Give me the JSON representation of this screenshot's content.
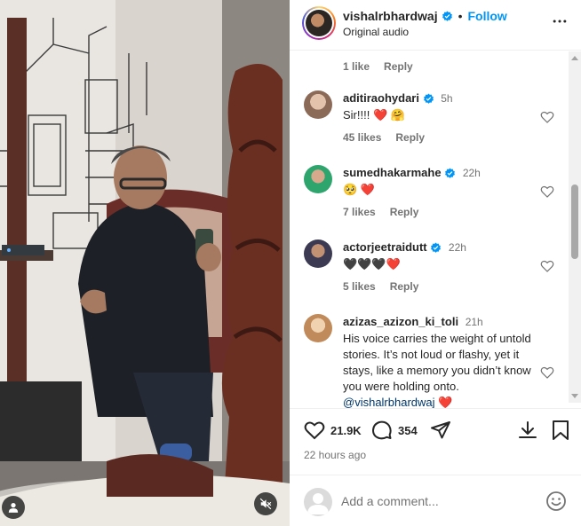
{
  "post": {
    "username": "vishalrbhardwaj",
    "follow_label": "Follow",
    "dot": "•",
    "audio": "Original audio",
    "more_icon": "more-options-icon"
  },
  "first_meta": {
    "likes": "1 like",
    "reply": "Reply"
  },
  "comments": [
    {
      "user": "aditirаohydari",
      "verified": true,
      "time": "5h",
      "text": "Sir!!!! ❤️ 🤗",
      "likes": "45 likes",
      "reply": "Reply",
      "avatar_color": "#c9a38a"
    },
    {
      "user": "sumedhakarmahe",
      "verified": true,
      "time": "22h",
      "text": "🥺 ❤️",
      "likes": "7 likes",
      "reply": "Reply",
      "avatar_color": "#2fa56e"
    },
    {
      "user": "actorjeetraidutt",
      "verified": true,
      "time": "22h",
      "text": "🖤🖤🖤❤️",
      "likes": "5 likes",
      "reply": "Reply",
      "avatar_color": "#3b3a52"
    },
    {
      "user": "azizas_azizon_ki_toli",
      "verified": false,
      "time": "21h",
      "text": "His voice carries the weight of untold stories. It’s not loud or flashy, yet it stays, like a memory you didn’t know you were holding onto.",
      "mention": "@vishalrbhardwaj",
      "trail": "❤️",
      "avatar_color": "#d9b382"
    }
  ],
  "actions": {
    "like_count": "21.9K",
    "comment_count": "354",
    "time_ago": "22 hours ago"
  },
  "add_comment": {
    "placeholder": "Add a comment..."
  },
  "colors": {
    "accent": "#0095f6",
    "verified": "#0095f6",
    "heart": "#ed4956"
  }
}
